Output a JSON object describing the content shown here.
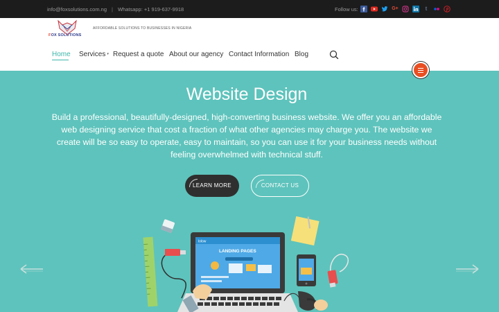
{
  "topbar": {
    "email": "info@foxsolutions.com.ng",
    "separator": "|",
    "whatsapp": "Whatsapp: +1 919-637-9918",
    "follow_label": "Follow us:",
    "social_icons": [
      {
        "name": "facebook-icon",
        "glyph": "f",
        "color": "#3b5998"
      },
      {
        "name": "youtube-icon",
        "glyph": "▶",
        "color": "#e02a20"
      },
      {
        "name": "twitter-icon",
        "glyph": "t",
        "color": "#1da1f2"
      },
      {
        "name": "google-plus-icon",
        "glyph": "G+",
        "color": "#dd4b39"
      },
      {
        "name": "instagram-icon",
        "glyph": "◎",
        "color": "#c13584"
      },
      {
        "name": "linkedin-icon",
        "glyph": "in",
        "color": "#0e76a8"
      },
      {
        "name": "tumblr-icon",
        "glyph": "t",
        "color": "#5a6f8f"
      },
      {
        "name": "flickr-icon",
        "glyph": "••",
        "color": "#ff0084"
      },
      {
        "name": "pinterest-icon",
        "glyph": "P",
        "color": "#cb2027"
      }
    ]
  },
  "header": {
    "logo_text_a": "F",
    "logo_text_b": "OX SOLUTIONS",
    "tagline": "AFFORDABLE SOLUTIONS TO BUSINESSES IN NIGERIA",
    "nav": [
      {
        "label": "Home",
        "active": true
      },
      {
        "label": "Services",
        "has_submenu": true
      },
      {
        "label": "Request a quote"
      },
      {
        "label": "About our agency"
      },
      {
        "label": "Contact Information"
      },
      {
        "label": "Blog"
      }
    ],
    "caret": "▾"
  },
  "hero": {
    "title": "Website Design",
    "body": "Build a professional, beautifully-designed, high-converting business website. We offer you an affordable web designing service that cost a fraction of what other agencies may charge you. The website we create will be so easy to operate, easy to maintain, so you can use it for your business needs without feeling overwhelmed with technical stuff.",
    "learn_more": "LEARN MORE",
    "contact_us": "CONTACT US",
    "screen_brand": "lolow",
    "screen_heading": "LANDING PAGES"
  },
  "colors": {
    "accent": "#3fb6aa",
    "hero_bg": "#5ec3bc",
    "menu_button": "#e84e22",
    "topbar_bg": "#1c1c1c"
  }
}
